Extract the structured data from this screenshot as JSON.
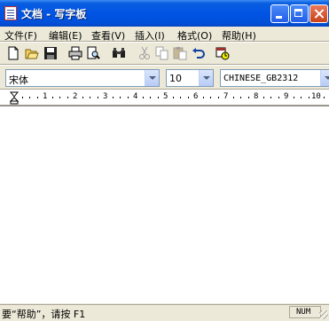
{
  "window": {
    "title": "文档 - 写字板"
  },
  "menu": [
    "文件(F)",
    "编辑(E)",
    "查看(V)",
    "插入(I)",
    "格式(O)",
    "帮助(H)"
  ],
  "toolbar": {
    "icons": [
      "new-document-icon",
      "open-folder-icon",
      "save-icon",
      "print-icon",
      "print-preview-icon",
      "find-icon",
      "cut-icon",
      "copy-icon",
      "paste-icon",
      "undo-icon",
      "date-time-icon"
    ]
  },
  "format": {
    "font": "宋体",
    "size": "10",
    "script": "CHINESE_GB2312"
  },
  "ruler": {
    "numbers": [
      "1",
      "2",
      "3",
      "4",
      "5",
      "6",
      "7",
      "8",
      "9",
      "10"
    ]
  },
  "status": {
    "help_text": "要“帮助”，请按 F1",
    "num": "NUM"
  },
  "colors": {
    "titlebar": "#0054e3",
    "chrome": "#ece9d8",
    "document": "#ffffff"
  }
}
